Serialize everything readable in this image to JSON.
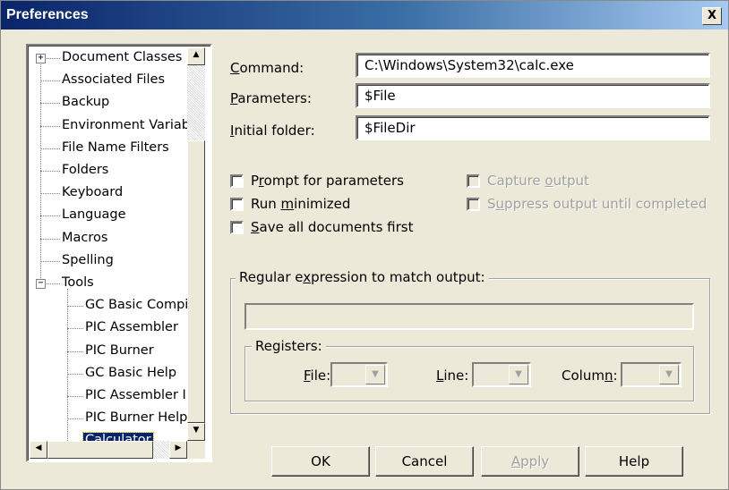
{
  "window": {
    "title": "Preferences",
    "close_label": "X"
  },
  "tree": {
    "items": [
      {
        "label": "Document Classes",
        "level": 0,
        "expander": "+"
      },
      {
        "label": "Associated Files",
        "level": 0
      },
      {
        "label": "Backup",
        "level": 0
      },
      {
        "label": "Environment Variab",
        "level": 0
      },
      {
        "label": "File Name Filters",
        "level": 0
      },
      {
        "label": "Folders",
        "level": 0
      },
      {
        "label": "Keyboard",
        "level": 0
      },
      {
        "label": "Language",
        "level": 0
      },
      {
        "label": "Macros",
        "level": 0
      },
      {
        "label": "Spelling",
        "level": 0
      },
      {
        "label": "Tools",
        "level": 0,
        "expander": "−"
      },
      {
        "label": "GC Basic Compi",
        "level": 1
      },
      {
        "label": "PIC Assembler",
        "level": 1
      },
      {
        "label": "PIC Burner",
        "level": 1
      },
      {
        "label": "GC Basic Help",
        "level": 1
      },
      {
        "label": "PIC Assembler I",
        "level": 1
      },
      {
        "label": "PIC Burner Help",
        "level": 1
      },
      {
        "label": "Calculator",
        "level": 1,
        "selected": true
      }
    ],
    "scroll_up_icon": "triangle-up-icon",
    "scroll_down_icon": "triangle-down-icon",
    "scroll_left_icon": "triangle-left-icon",
    "scroll_right_icon": "triangle-right-icon"
  },
  "form": {
    "command": {
      "label_key": "C",
      "label_rest": "ommand:",
      "value": "C:\\Windows\\System32\\calc.exe"
    },
    "parameters": {
      "label_key": "P",
      "label_rest": "arameters:",
      "value": "$File"
    },
    "initial_folder": {
      "label_key": "I",
      "label_rest": "nitial folder:",
      "value": "$FileDir"
    },
    "prompt": {
      "pre": "P",
      "key": "r",
      "post": "ompt for parameters"
    },
    "run_min": {
      "pre": "Run ",
      "key": "m",
      "post": "inimized"
    },
    "save_all": {
      "pre": "",
      "key": "S",
      "post": "ave all documents first"
    },
    "capture": {
      "pre": "Capture ",
      "key": "o",
      "post": "utput"
    },
    "suppress": {
      "pre": "S",
      "key": "u",
      "post": "ppress output until completed"
    },
    "regex_group": {
      "pre": "Regular e",
      "key": "x",
      "post": "pression to match output:"
    },
    "registers": {
      "label": "Registers:",
      "file": {
        "pre": "",
        "key": "F",
        "post": "ile:"
      },
      "line": {
        "pre": "",
        "key": "L",
        "post": "ine:"
      },
      "column": {
        "pre": "Colum",
        "key": "n",
        "post": ":"
      }
    }
  },
  "buttons": {
    "ok": "OK",
    "cancel": "Cancel",
    "apply": {
      "pre": "",
      "key": "A",
      "post": "pply"
    },
    "help": "Help"
  }
}
